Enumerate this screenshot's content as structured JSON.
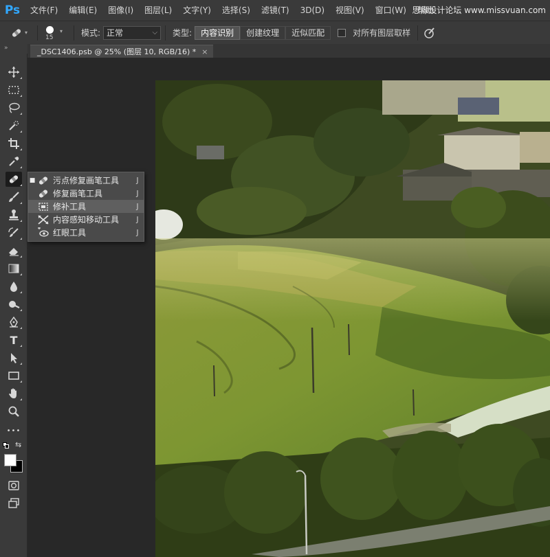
{
  "app": {
    "logo": "Ps"
  },
  "menu": [
    "文件(F)",
    "编辑(E)",
    "图像(I)",
    "图层(L)",
    "文字(Y)",
    "选择(S)",
    "滤镜(T)",
    "3D(D)",
    "视图(V)",
    "窗口(W)",
    "帮助"
  ],
  "watermark": "思缘设计论坛 www.missvuan.com",
  "options": {
    "brush_size": "15",
    "mode_label": "模式:",
    "mode_value": "正常",
    "type_label": "类型:",
    "type_buttons": [
      "内容识别",
      "创建纹理",
      "近似匹配"
    ],
    "type_active_index": 0,
    "sample_all_label": "对所有图层取样",
    "sample_all_checked": false
  },
  "panel_collapse": "»",
  "document_tab": {
    "title": "_DSC1406.psb @ 25% (图层 10, RGB/16) *",
    "close": "×"
  },
  "tools": [
    {
      "name": "move-icon",
      "active": false
    },
    {
      "name": "marquee-icon",
      "active": false
    },
    {
      "name": "lasso-icon",
      "active": false
    },
    {
      "name": "quick-select-icon",
      "active": false
    },
    {
      "name": "crop-icon",
      "active": false
    },
    {
      "name": "eyedropper-icon",
      "active": false
    },
    {
      "name": "healing-brush-icon",
      "active": true
    },
    {
      "name": "brush-icon",
      "active": false
    },
    {
      "name": "stamp-icon",
      "active": false
    },
    {
      "name": "history-brush-icon",
      "active": false
    },
    {
      "name": "eraser-icon",
      "active": false
    },
    {
      "name": "gradient-icon",
      "active": false
    },
    {
      "name": "blur-icon",
      "active": false
    },
    {
      "name": "dodge-icon",
      "active": false
    },
    {
      "name": "pen-icon",
      "active": false
    },
    {
      "name": "type-icon",
      "active": false
    },
    {
      "name": "path-select-icon",
      "active": false
    },
    {
      "name": "rectangle-icon",
      "active": false
    },
    {
      "name": "hand-icon",
      "active": false
    },
    {
      "name": "zoom-icon",
      "active": false
    },
    {
      "name": "more-icon",
      "active": false
    }
  ],
  "type_tool_glyph": "T",
  "more_glyph": "•••",
  "colors": {
    "foreground": "#ffffff",
    "background": "#000000",
    "accent": "#31a8ff"
  },
  "flyout": {
    "items": [
      {
        "label": "污点修复画笔工具",
        "key": "J",
        "icon": "spot-healing-icon",
        "current": true,
        "highlighted": false
      },
      {
        "label": "修复画笔工具",
        "key": "J",
        "icon": "healing-brush-icon",
        "current": false,
        "highlighted": false
      },
      {
        "label": "修补工具",
        "key": "J",
        "icon": "patch-icon",
        "current": false,
        "highlighted": true
      },
      {
        "label": "内容感知移动工具",
        "key": "J",
        "icon": "content-aware-move-icon",
        "current": false,
        "highlighted": false
      },
      {
        "label": "红眼工具",
        "key": "J",
        "icon": "red-eye-icon",
        "current": false,
        "highlighted": false
      }
    ]
  }
}
